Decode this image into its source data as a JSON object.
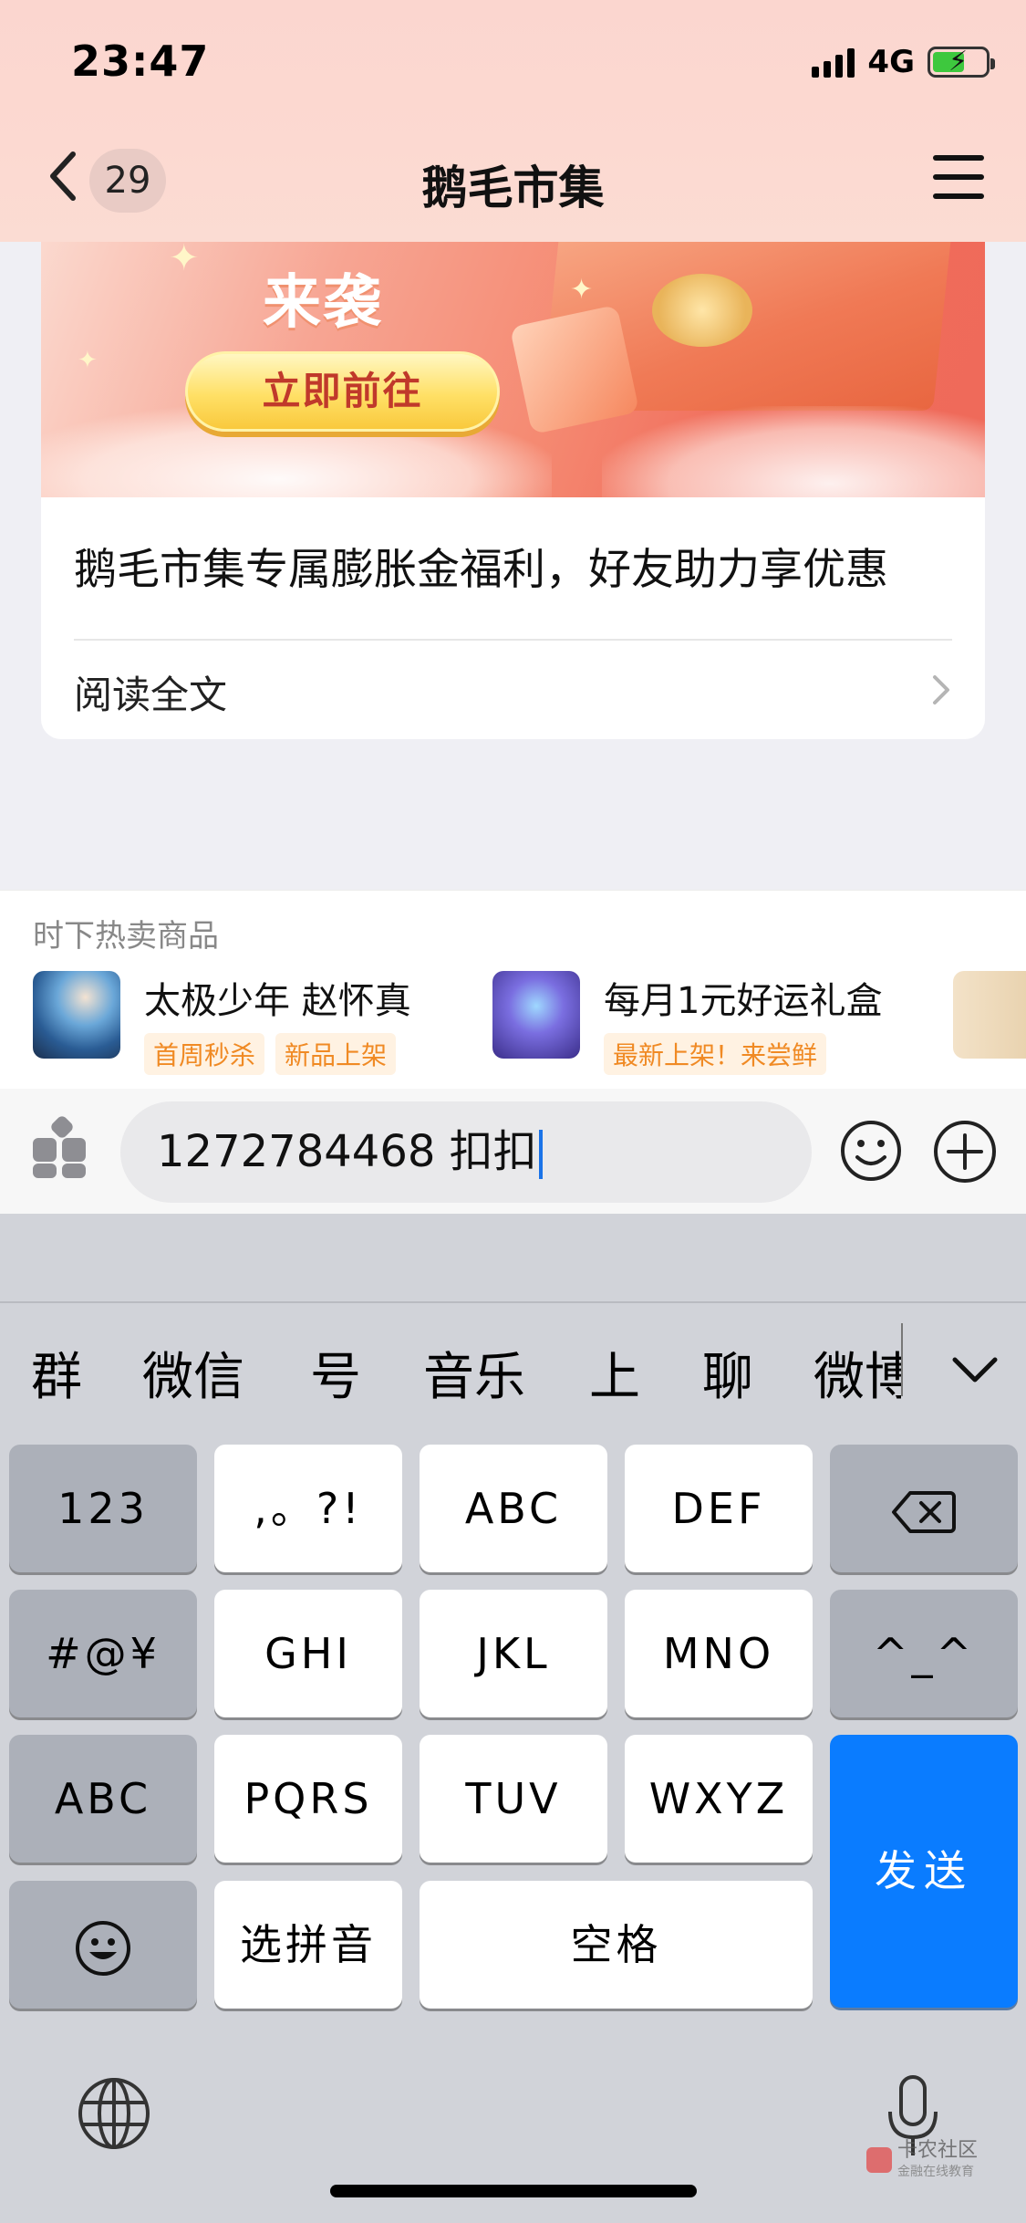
{
  "status_bar": {
    "time": "23:47",
    "network": "4G"
  },
  "nav": {
    "back_count": "29",
    "title": "鹅毛市集"
  },
  "article": {
    "banner_heading": "来袭",
    "banner_button": "立即前往",
    "title": "鹅毛市集专属膨胀金福利，好友助力享优惠",
    "read_more": "阅读全文"
  },
  "hot_products": {
    "title": "时下热卖商品",
    "items": [
      {
        "name": "太极少年 赵怀真",
        "tags": [
          "首周秒杀",
          "新品上架"
        ]
      },
      {
        "name": "每月1元好运礼盒",
        "tags": [
          "最新上架！来尝鲜"
        ]
      }
    ]
  },
  "composer": {
    "text": "1272784468 扣扣"
  },
  "keyboard": {
    "candidates": [
      "群",
      "微信",
      "号",
      "音乐",
      "上",
      "聊",
      "微博"
    ],
    "keys": {
      "num": "123",
      "punct": ",。?!",
      "abc": "ABC",
      "def": "DEF",
      "symbols": "#@¥",
      "ghi": "GHI",
      "jkl": "JKL",
      "mno": "MNO",
      "emoticon": "^_^",
      "abc_switch": "ABC",
      "pqrs": "PQRS",
      "tuv": "TUV",
      "wxyz": "WXYZ",
      "send": "发送",
      "pinyin": "选拼音",
      "space": "空格"
    }
  },
  "watermark": {
    "title": "卡农社区",
    "subtitle": "金融在线教育"
  }
}
